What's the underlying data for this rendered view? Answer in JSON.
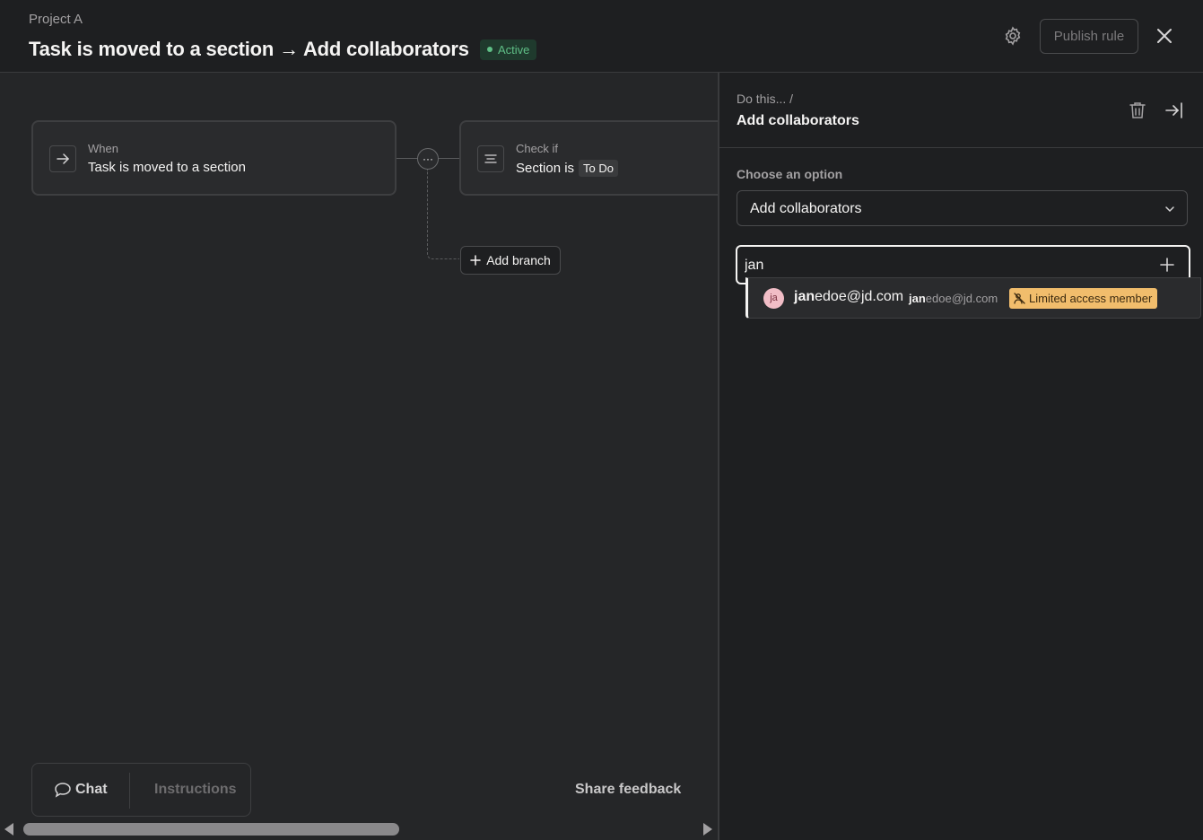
{
  "header": {
    "project": "Project A",
    "title": "Task is moved to a section → Add collaborators",
    "status": "Active",
    "publish_label": "Publish rule"
  },
  "canvas": {
    "trigger": {
      "label": "When",
      "value": "Task is moved to a section"
    },
    "condition": {
      "label": "Check if",
      "value": "Section is",
      "pill": "To Do"
    },
    "add_branch_label": "Add branch",
    "dots": "···"
  },
  "bottom": {
    "chat_label": "Chat",
    "instructions_label": "Instructions",
    "share_feedback": "Share feedback"
  },
  "panel": {
    "breadcrumb": "Do this...  /",
    "title": "Add collaborators",
    "choose_label": "Choose an option",
    "selected_option": "Add collaborators",
    "search_value": "jan",
    "suggestion": {
      "avatar_initials": "ja",
      "match": "jan",
      "name_rest": "edoe@jd.com",
      "email_rest": "edoe@jd.com",
      "badge": "Limited access member"
    }
  },
  "colors": {
    "active_green": "#5fbf86",
    "limited_badge": "#f1bd6c",
    "avatar_pink": "#f1bdc6"
  },
  "icons": [
    "gear-icon",
    "close-icon",
    "arrow-right-icon",
    "filter-lines-icon",
    "plus-icon",
    "chat-bubble-icon",
    "trash-icon",
    "collapse-panel-icon",
    "chevron-down-icon",
    "limited-access-icon"
  ]
}
